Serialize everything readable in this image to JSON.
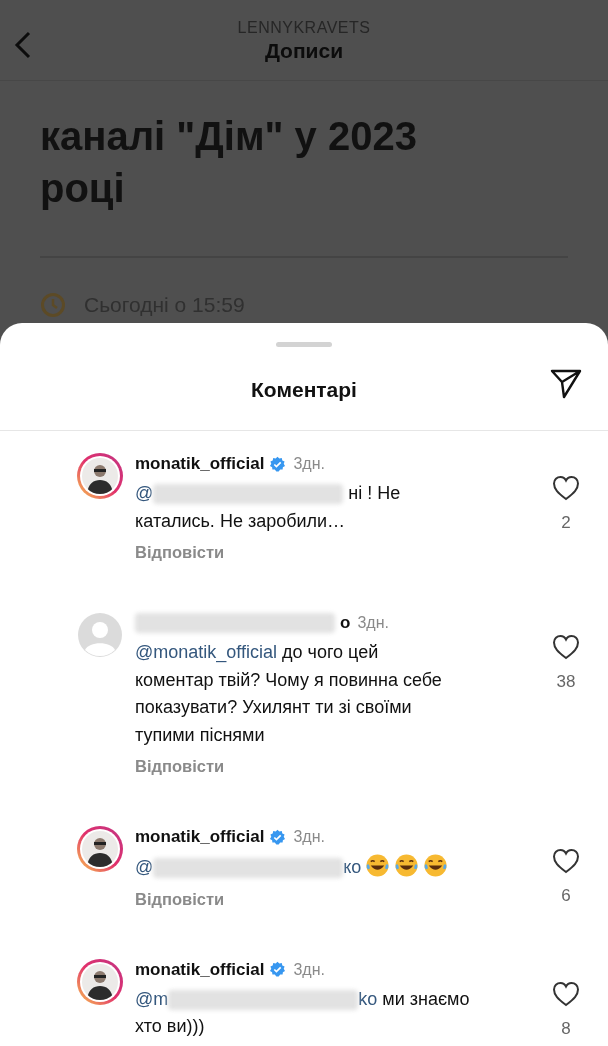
{
  "header": {
    "account": "LENNYKRAVETS",
    "title": "Дописи"
  },
  "article": {
    "title_lines": [
      "каналі \"Дім\" у 2023",
      "році"
    ],
    "date": "Сьогодні о 15:59"
  },
  "sheet": {
    "title": "Коментарі"
  },
  "comments": [
    {
      "avatar": {
        "kind": "story"
      },
      "user_parts": [
        {
          "kind": "text",
          "text": "monatik_official"
        }
      ],
      "verified": true,
      "time": "3дн.",
      "body": [
        {
          "kind": "mention",
          "text": "@"
        },
        {
          "kind": "redacted"
        },
        {
          "kind": "text",
          "text": " ні ! Не\nкатались. Не заробили…"
        }
      ],
      "reply": "Відповісти",
      "likes": "2"
    },
    {
      "avatar": {
        "kind": "default"
      },
      "user_parts": [
        {
          "kind": "redacted"
        },
        {
          "kind": "text",
          "text": "о"
        }
      ],
      "verified": false,
      "time": "3дн.",
      "body": [
        {
          "kind": "mention",
          "text": "@monatik_official"
        },
        {
          "kind": "text",
          "text": " до чого цей\nкоментар твій? Чому я повинна себе\nпоказувати? Ухилянт ти зі своїми\nтупими піснями"
        }
      ],
      "reply": "Відповісти",
      "likes": "38"
    },
    {
      "avatar": {
        "kind": "story"
      },
      "user_parts": [
        {
          "kind": "text",
          "text": "monatik_official"
        }
      ],
      "verified": true,
      "time": "3дн.",
      "body": [
        {
          "kind": "mention",
          "text": "@"
        },
        {
          "kind": "redacted"
        },
        {
          "kind": "mention",
          "text": "ко"
        },
        {
          "kind": "emoji"
        },
        {
          "kind": "emoji"
        },
        {
          "kind": "emoji"
        }
      ],
      "reply": "Відповісти",
      "likes": "6"
    },
    {
      "avatar": {
        "kind": "story"
      },
      "user_parts": [
        {
          "kind": "text",
          "text": "monatik_official"
        }
      ],
      "verified": true,
      "time": "3дн.",
      "body": [
        {
          "kind": "mention",
          "text": "@m"
        },
        {
          "kind": "redacted"
        },
        {
          "kind": "mention",
          "text": "ko"
        },
        {
          "kind": "text",
          "text": " ми знаємо\nхто ви)))"
        }
      ],
      "likes": "8"
    }
  ]
}
